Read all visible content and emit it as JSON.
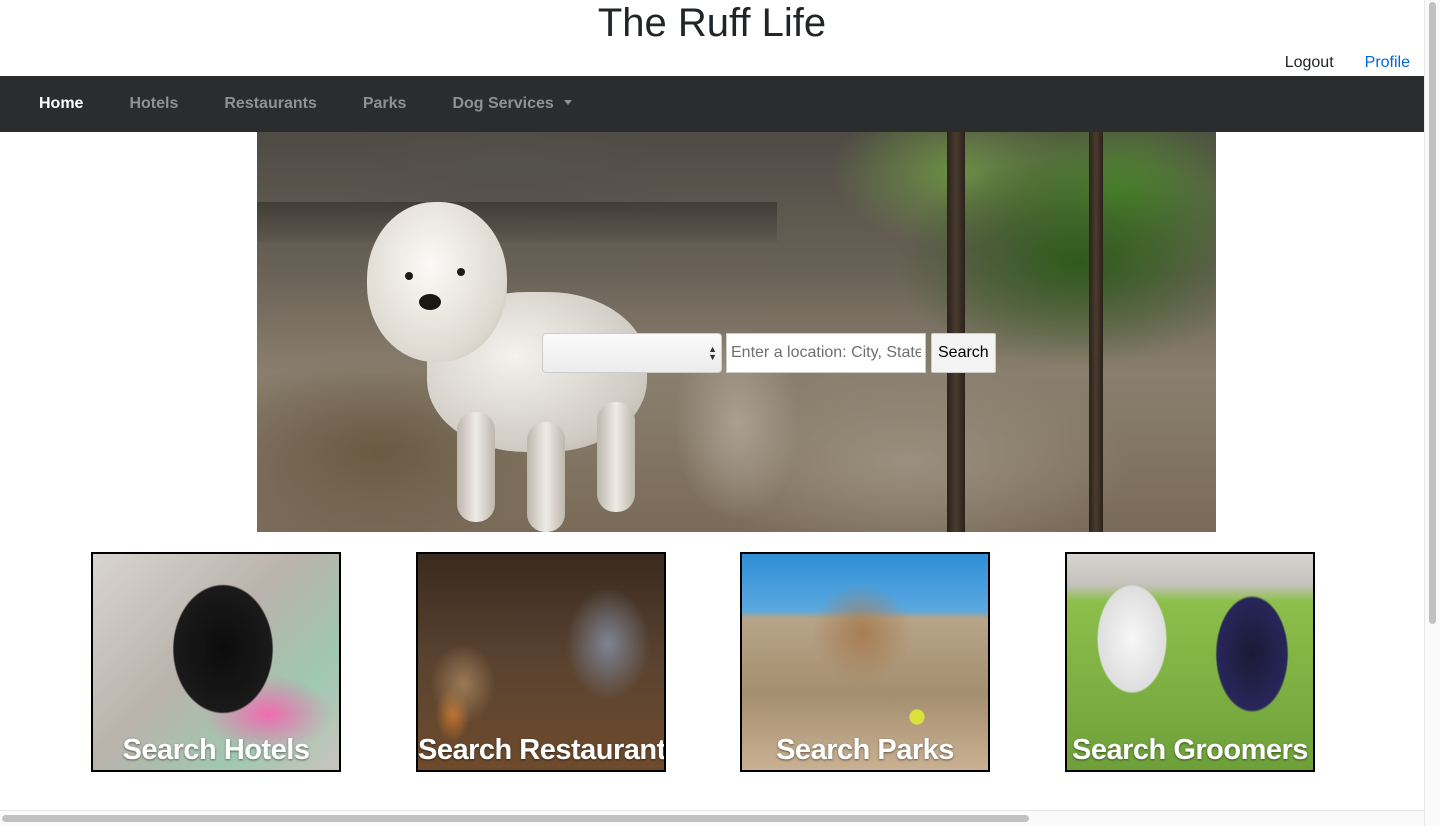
{
  "site": {
    "title": "The Ruff Life"
  },
  "top_links": {
    "logout": "Logout",
    "profile": "Profile"
  },
  "nav": {
    "items": [
      {
        "label": "Home",
        "active": true
      },
      {
        "label": "Hotels",
        "active": false
      },
      {
        "label": "Restaurants",
        "active": false
      },
      {
        "label": "Parks",
        "active": false
      },
      {
        "label": "Dog Services",
        "active": false,
        "dropdown": true
      }
    ]
  },
  "search": {
    "category_value": "",
    "location_placeholder": "Enter a location: City, State",
    "button_label": "Search"
  },
  "cards": [
    {
      "label": "Search Hotels"
    },
    {
      "label": "Search Restaurants"
    },
    {
      "label": "Search Parks"
    },
    {
      "label": "Search Groomers"
    }
  ],
  "colors": {
    "navbar_bg": "#2b2c2e",
    "nav_active": "#ffffff",
    "nav_inactive": "#8f9194",
    "profile_link": "#0366d6"
  }
}
